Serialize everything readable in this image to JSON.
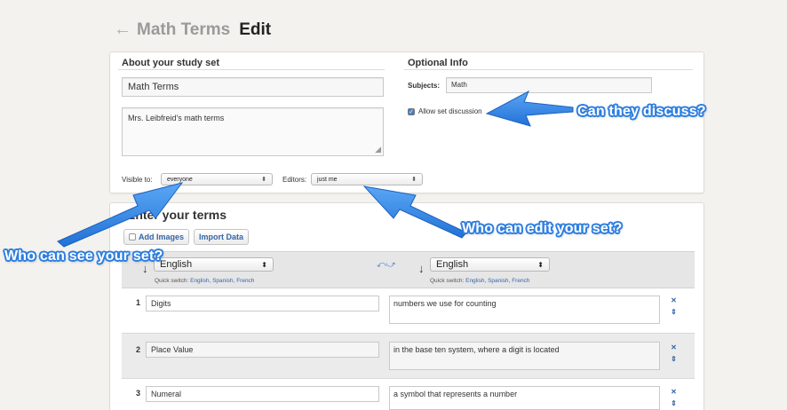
{
  "header": {
    "back_icon": "←",
    "set_title": "Math Terms",
    "mode": "Edit"
  },
  "about": {
    "heading": "About your study set",
    "title_value": "Math Terms",
    "description_value": "Mrs. Leibfreid's math terms",
    "visible_label": "Visible to:",
    "visible_value": "everyone",
    "editors_label": "Editors:",
    "editors_value": "just me"
  },
  "optional": {
    "heading": "Optional Info",
    "subjects_label": "Subjects:",
    "subjects_value": "Math",
    "discussion_label": "Allow set discussion",
    "discussion_checked": true
  },
  "terms_section": {
    "heading": "Enter your terms",
    "add_images_label": "Add Images",
    "import_label": "Import Data",
    "term_language": "English",
    "definition_language": "English",
    "quick_switch_label": "Quick switch:",
    "quick_langs": [
      "English",
      "Spanish",
      "French"
    ],
    "rows": [
      {
        "num": "1",
        "term": "Digits",
        "definition": "numbers we use for counting"
      },
      {
        "num": "2",
        "term": "Place Value",
        "definition": "in the base ten system, where a digit is located"
      },
      {
        "num": "3",
        "term": "Numeral",
        "definition": "a symbol that represents a number"
      }
    ]
  },
  "callouts": {
    "discuss": "Can they discuss?",
    "edit": "Who can edit your set?",
    "see": "Who can see your set?"
  },
  "colors": {
    "callout_blue": "#2f7fe0",
    "link_blue": "#3565a8"
  }
}
